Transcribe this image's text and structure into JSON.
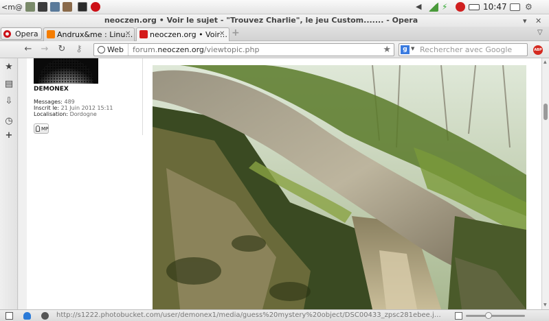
{
  "system_bar": {
    "menu_text": "<m@",
    "clock": "10:47"
  },
  "window": {
    "title": "neoczen.org • Voir le sujet - \"Trouvez Charlie\", le jeu Custom....... - Opera"
  },
  "tabs": {
    "menu_label": "Opera",
    "items": [
      {
        "label": "Andrux&me : Linu…"
      },
      {
        "label": "neoczen.org • Voir…"
      }
    ]
  },
  "navigation": {
    "badge_label": "Web",
    "url_prefix": "forum.",
    "url_domain": "neoczen.org",
    "url_path": "/viewtopic.php",
    "search_placeholder": "Rechercher avec Google",
    "adblock_label": "ABP"
  },
  "profile": {
    "username": "DEMONEX",
    "messages_label": "Messages:",
    "messages_value": "489",
    "joined_label": "Inscrit le:",
    "joined_value": "21 Juin 2012 15:11",
    "location_label": "Localisation:",
    "location_value": "Dordogne",
    "pm_label": "MP"
  },
  "status_bar": {
    "url": "http://s1222.photobucket.com/user/demonex1/media/guess%20mystery%20object/DSC00433_zpsc281ebee.j…",
    "zoom_level": ""
  },
  "colors": {
    "opera_red": "#cc0f16",
    "blogger_orange": "#f57d00",
    "neoczen_red": "#d41c1c",
    "google_blue": "#3a7be0"
  },
  "icons": {
    "sidebar": [
      "bookmark-star-icon",
      "notes-icon",
      "downloads-icon",
      "history-clock-icon",
      "add-panel-icon"
    ]
  }
}
